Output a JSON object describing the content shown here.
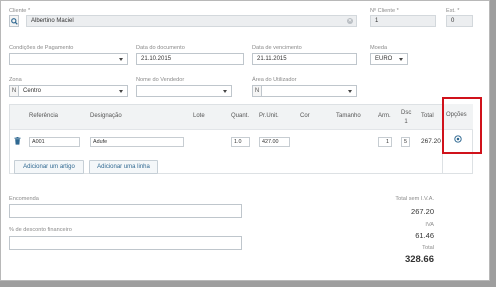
{
  "customer": {
    "label": "Cliente *",
    "value": "Albertino Maciel"
  },
  "customer_no": {
    "label": "Nº Cliente *",
    "value": "1"
  },
  "establishment": {
    "label": "Est. *",
    "value": "0"
  },
  "payment_terms": {
    "label": "Condições de Pagamento",
    "value": ""
  },
  "document_date": {
    "label": "Data do documento",
    "value": "21.10.2015"
  },
  "due_date": {
    "label": "Data de vencimento",
    "value": "21.11.2015"
  },
  "currency": {
    "label": "Moeda",
    "value": "EURO"
  },
  "zone": {
    "label": "Zona",
    "prefix": "N",
    "value": "Centro"
  },
  "seller": {
    "label": "Nome do Vendedor",
    "value": ""
  },
  "user_area": {
    "label": "Área do Utilizador",
    "prefix": "N",
    "value": ""
  },
  "table": {
    "headers": {
      "reference": "Referência",
      "designation": "Designação",
      "batch": "Lote",
      "quantity": "Quant.",
      "unit_price": "Pr.Unit.",
      "color": "Cor",
      "size": "Tamanho",
      "warehouse": "Arm.",
      "discount": "Dsc 1",
      "total": "Total",
      "options": "Opções"
    },
    "row": {
      "reference": "A001",
      "designation": "Adufe",
      "quantity": "1.0",
      "unit_price": "427.00",
      "warehouse": "1",
      "discount": "5",
      "total": "267.20"
    },
    "add_item_label": "Adicionar um artigo",
    "add_line_label": "Adicionar uma linha"
  },
  "order": {
    "label": "Encomenda",
    "value": ""
  },
  "financial_discount": {
    "label": "% de desconto financeiro",
    "value": ""
  },
  "totals": {
    "subtotal_label": "Total sem I.V.A.",
    "subtotal_value": "267.20",
    "vat_label": "IVA",
    "vat_value": "61.46",
    "total_label": "Total",
    "total_value": "328.66"
  },
  "colors": {
    "highlight": "#d0121b",
    "accent": "#2f6891"
  }
}
